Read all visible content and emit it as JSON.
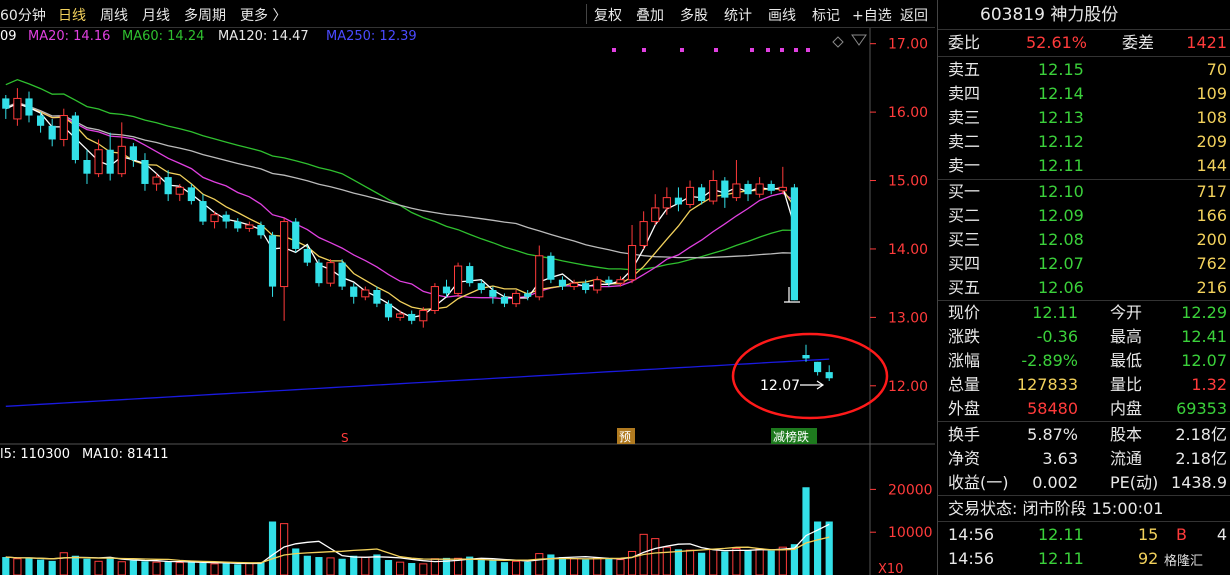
{
  "toolbar": {
    "period": "60分钟",
    "daily": "日线",
    "weekly": "周线",
    "monthly": "月线",
    "multi_period": "多周期",
    "more": "更多 〉",
    "restore_rights": "复权",
    "overlay": "叠加",
    "multi_stock": "多股",
    "stats": "统计",
    "draw_line": "画线",
    "mark": "标记",
    "add_watch": "+自选",
    "back": "返回"
  },
  "ma_legend": {
    "ma5_frag": "09",
    "ma20": "MA20: 14.16",
    "ma60": "MA60: 14.24",
    "ma120": "MA120: 14.47",
    "ma250": "MA250: 12.39"
  },
  "vol_legend": {
    "vol_frag": "l5: 110300",
    "ma10": "MA10: 81411"
  },
  "colors": {
    "up": "#ff3b3b",
    "down": "#33e0e8",
    "ma5": "#ffffff",
    "ma10": "#f2d15c",
    "ma20": "#e040e0",
    "ma60": "#2fc02f",
    "ma120": "#bbbbbb",
    "ma250": "#1a1ae0",
    "annotation": "#ff1a1a"
  },
  "price_axis": {
    "ticks": [
      "17.00",
      "16.00",
      "15.00",
      "14.00",
      "13.00",
      "12.00"
    ]
  },
  "volume_axis": {
    "ticks": [
      "20000",
      "10000"
    ],
    "unit": "X10"
  },
  "markers": {
    "s_label": "S",
    "pre_label": "预",
    "drop_label": "减榜跌"
  },
  "annotation": {
    "price_label": "12.07"
  },
  "chart_data": {
    "type": "candlestick",
    "price_range": [
      11.5,
      17.2
    ],
    "candles": [
      [
        16.2,
        16.05,
        16.25,
        15.9
      ],
      [
        15.9,
        16.2,
        16.35,
        15.8
      ],
      [
        16.2,
        15.95,
        16.3,
        15.85
      ],
      [
        15.95,
        15.8,
        16.0,
        15.7
      ],
      [
        15.8,
        15.6,
        15.9,
        15.5
      ],
      [
        15.6,
        15.95,
        16.05,
        15.5
      ],
      [
        15.95,
        15.3,
        16.0,
        15.25
      ],
      [
        15.3,
        15.1,
        15.45,
        14.95
      ],
      [
        15.1,
        15.45,
        15.6,
        15.05
      ],
      [
        15.45,
        15.1,
        15.7,
        15.0
      ],
      [
        15.1,
        15.5,
        15.85,
        15.05
      ],
      [
        15.5,
        15.3,
        15.55,
        15.2
      ],
      [
        15.3,
        14.95,
        15.4,
        14.85
      ],
      [
        14.95,
        15.05,
        15.1,
        14.85
      ],
      [
        15.05,
        14.8,
        15.15,
        14.7
      ],
      [
        14.8,
        14.9,
        14.95,
        14.7
      ],
      [
        14.9,
        14.7,
        14.95,
        14.65
      ],
      [
        14.7,
        14.4,
        14.8,
        14.35
      ],
      [
        14.4,
        14.5,
        14.55,
        14.3
      ],
      [
        14.5,
        14.4,
        14.55,
        14.3
      ],
      [
        14.4,
        14.3,
        14.45,
        14.25
      ],
      [
        14.3,
        14.35,
        14.4,
        14.25
      ],
      [
        14.35,
        14.2,
        14.4,
        14.15
      ],
      [
        14.2,
        13.45,
        14.25,
        13.3
      ],
      [
        13.45,
        14.4,
        14.45,
        12.95
      ],
      [
        14.4,
        14.0,
        14.45,
        13.95
      ],
      [
        14.0,
        13.8,
        14.05,
        13.75
      ],
      [
        13.8,
        13.5,
        13.85,
        13.45
      ],
      [
        13.5,
        13.8,
        13.85,
        13.45
      ],
      [
        13.8,
        13.45,
        13.85,
        13.4
      ],
      [
        13.45,
        13.3,
        13.5,
        13.2
      ],
      [
        13.3,
        13.4,
        13.45,
        13.25
      ],
      [
        13.4,
        13.2,
        13.45,
        13.15
      ],
      [
        13.2,
        13.0,
        13.25,
        12.95
      ],
      [
        13.0,
        13.05,
        13.1,
        12.95
      ],
      [
        13.05,
        12.95,
        13.1,
        12.9
      ],
      [
        12.95,
        13.1,
        13.15,
        12.85
      ],
      [
        13.1,
        13.45,
        13.5,
        13.05
      ],
      [
        13.45,
        13.35,
        13.55,
        13.3
      ],
      [
        13.35,
        13.75,
        13.8,
        13.3
      ],
      [
        13.75,
        13.5,
        13.8,
        13.45
      ],
      [
        13.5,
        13.4,
        13.55,
        13.35
      ],
      [
        13.4,
        13.3,
        13.45,
        13.2
      ],
      [
        13.3,
        13.2,
        13.35,
        13.15
      ],
      [
        13.2,
        13.35,
        13.4,
        13.15
      ],
      [
        13.35,
        13.3,
        13.4,
        13.25
      ],
      [
        13.3,
        13.9,
        14.05,
        13.25
      ],
      [
        13.9,
        13.55,
        13.95,
        13.5
      ],
      [
        13.55,
        13.45,
        13.6,
        13.4
      ],
      [
        13.45,
        13.5,
        13.55,
        13.4
      ],
      [
        13.5,
        13.4,
        13.55,
        13.35
      ],
      [
        13.4,
        13.55,
        13.6,
        13.35
      ],
      [
        13.55,
        13.5,
        13.6,
        13.45
      ],
      [
        13.5,
        13.55,
        13.6,
        13.45
      ],
      [
        13.55,
        14.05,
        14.35,
        13.5
      ],
      [
        14.05,
        14.4,
        14.55,
        14.0
      ],
      [
        14.4,
        14.6,
        14.8,
        14.35
      ],
      [
        14.6,
        14.75,
        14.9,
        14.5
      ],
      [
        14.75,
        14.65,
        14.9,
        14.55
      ],
      [
        14.65,
        14.9,
        15.0,
        14.6
      ],
      [
        14.9,
        14.7,
        14.95,
        14.65
      ],
      [
        14.7,
        15.0,
        15.15,
        14.65
      ],
      [
        15.0,
        14.75,
        15.05,
        14.6
      ],
      [
        14.75,
        14.95,
        15.3,
        14.7
      ],
      [
        14.95,
        14.8,
        15.0,
        14.7
      ],
      [
        14.8,
        14.95,
        15.05,
        14.75
      ],
      [
        14.95,
        14.85,
        15.0,
        14.8
      ],
      [
        14.85,
        14.9,
        15.2,
        14.8
      ],
      [
        14.9,
        13.25,
        14.95,
        13.25
      ],
      [
        12.45,
        12.4,
        12.6,
        12.35
      ],
      [
        12.35,
        12.2,
        12.35,
        12.15
      ],
      [
        12.2,
        12.11,
        12.3,
        12.07
      ]
    ],
    "volume_range": [
      0,
      25000
    ],
    "volumes": [
      4200,
      3800,
      4000,
      3600,
      3300,
      5200,
      4500,
      3800,
      3200,
      4000,
      3100,
      3400,
      3200,
      3000,
      3100,
      2900,
      3000,
      2800,
      2600,
      2800,
      2500,
      2700,
      3000,
      12500,
      12000,
      6200,
      4500,
      4200,
      4000,
      3800,
      4500,
      4200,
      4800,
      3500,
      3000,
      2800,
      2600,
      3800,
      4000,
      3900,
      4300,
      3500,
      3400,
      3000,
      3200,
      3100,
      5000,
      4800,
      4200,
      3800,
      3600,
      4000,
      3800,
      3600,
      5500,
      9500,
      8500,
      6500,
      6000,
      5800,
      5200,
      6000,
      5500,
      6200,
      5800,
      6100,
      5700,
      6500,
      7200,
      20500,
      12500,
      12500
    ]
  },
  "quote": {
    "code": "603819",
    "name": "神力股份",
    "weibi_label": "委比",
    "weibi_value": "52.61%",
    "weicha_label": "委差",
    "weicha_value": "1421",
    "asks": [
      {
        "label": "卖五",
        "price": "12.15",
        "vol": "70"
      },
      {
        "label": "卖四",
        "price": "12.14",
        "vol": "109"
      },
      {
        "label": "卖三",
        "price": "12.13",
        "vol": "108"
      },
      {
        "label": "卖二",
        "price": "12.12",
        "vol": "209"
      },
      {
        "label": "卖一",
        "price": "12.11",
        "vol": "144"
      }
    ],
    "bids": [
      {
        "label": "买一",
        "price": "12.10",
        "vol": "717"
      },
      {
        "label": "买二",
        "price": "12.09",
        "vol": "166"
      },
      {
        "label": "买三",
        "price": "12.08",
        "vol": "200"
      },
      {
        "label": "买四",
        "price": "12.07",
        "vol": "762"
      },
      {
        "label": "买五",
        "price": "12.06",
        "vol": "216"
      }
    ],
    "stats": [
      {
        "l1": "现价",
        "v1": "12.11",
        "c1": "green",
        "l2": "今开",
        "v2": "12.29",
        "c2": "green"
      },
      {
        "l1": "涨跌",
        "v1": "-0.36",
        "c1": "green",
        "l2": "最高",
        "v2": "12.41",
        "c2": "green"
      },
      {
        "l1": "涨幅",
        "v1": "-2.89%",
        "c1": "green",
        "l2": "最低",
        "v2": "12.07",
        "c2": "green"
      },
      {
        "l1": "总量",
        "v1": "127833",
        "c1": "yellow",
        "l2": "量比",
        "v2": "1.32",
        "c2": "red"
      },
      {
        "l1": "外盘",
        "v1": "58480",
        "c1": "red",
        "l2": "内盘",
        "v2": "69353",
        "c2": "green"
      }
    ],
    "fundamentals": [
      {
        "l1": "换手",
        "v1": "5.87%",
        "l2": "股本",
        "v2": "2.18亿"
      },
      {
        "l1": "净资",
        "v1": "3.63",
        "l2": "流通",
        "v2": "2.18亿"
      },
      {
        "l1": "收益(一)",
        "v1": "0.002",
        "l2": "PE(动)",
        "v2": "1438.9"
      }
    ],
    "trade_status": "交易状态: 闭市阶段 15:00:01",
    "ticks": [
      {
        "time": "14:56",
        "price": "12.11",
        "vol": "15",
        "side": "B",
        "n": "4"
      },
      {
        "time": "14:56",
        "price": "12.11",
        "vol": "92",
        "side": "",
        "n": ""
      }
    ]
  },
  "watermark": "格隆汇"
}
